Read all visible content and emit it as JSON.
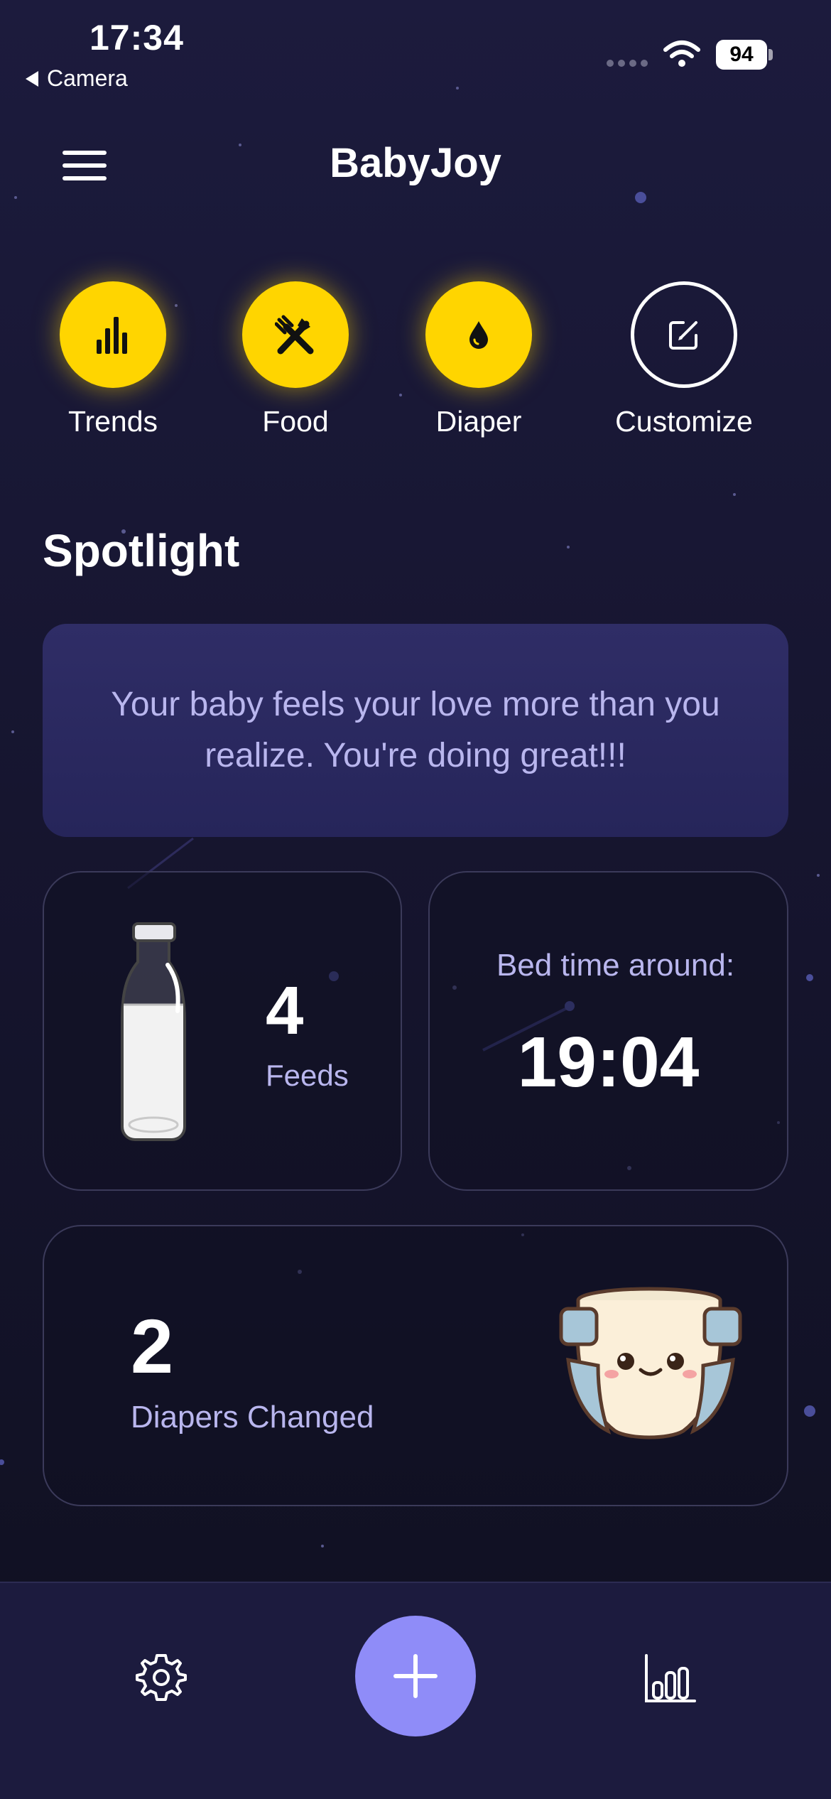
{
  "status_bar": {
    "time": "17:34",
    "back_label": "Camera",
    "battery": "94"
  },
  "header": {
    "title": "BabyJoy",
    "menu_icon": "hamburger-menu-icon"
  },
  "quick_actions": [
    {
      "label": "Trends",
      "icon": "bar-chart-icon",
      "color": "#ffd500"
    },
    {
      "label": "Food",
      "icon": "fork-knife-icon",
      "color": "#ffd500"
    },
    {
      "label": "Diaper",
      "icon": "droplet-icon",
      "color": "#ffd500"
    },
    {
      "label": "Customize",
      "icon": "edit-icon",
      "color": "outline"
    }
  ],
  "spotlight": {
    "title": "Spotlight",
    "quote": "Your baby feels your love more than you realize. You're doing great!!!"
  },
  "feeds": {
    "count": "4",
    "label": "Feeds",
    "icon": "milk-bottle-icon"
  },
  "bedtime": {
    "label": "Bed time around:",
    "time": "19:04"
  },
  "diapers": {
    "count": "2",
    "label": "Diapers Changed",
    "icon": "diaper-illustration"
  },
  "bottom_nav": {
    "settings_icon": "gear-icon",
    "add_icon": "plus-icon",
    "stats_icon": "stats-icon",
    "accent_color": "#8f8cf8"
  },
  "colors": {
    "background": "#1a1938",
    "accent_yellow": "#ffd500",
    "text_muted": "#b9b6ee"
  }
}
